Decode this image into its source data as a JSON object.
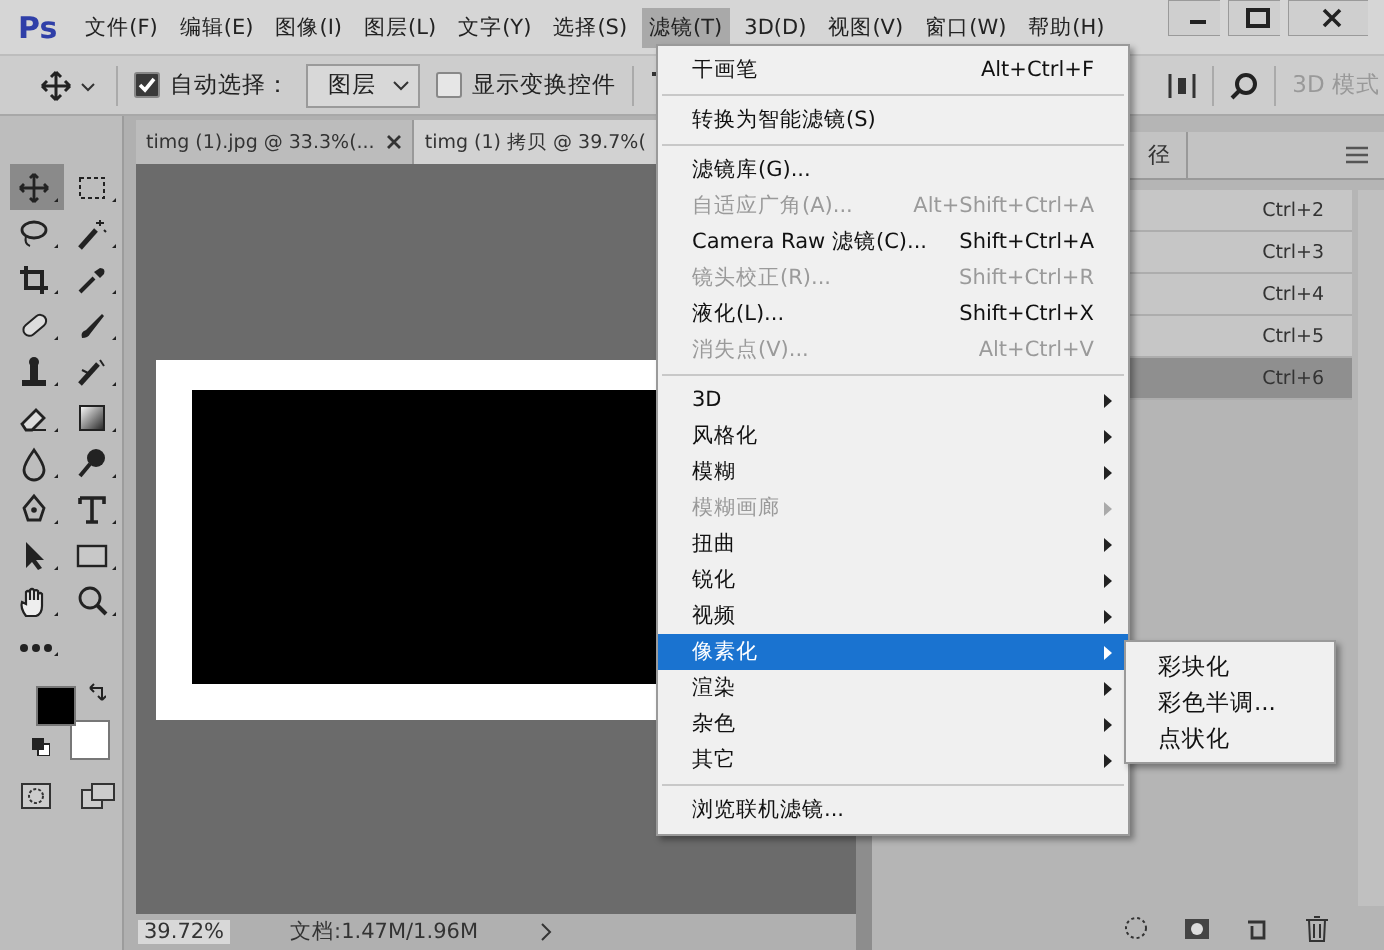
{
  "app_logo": "Ps",
  "menu_bar": [
    {
      "label": "文件(F)",
      "selected": false
    },
    {
      "label": "编辑(E)",
      "selected": false
    },
    {
      "label": "图像(I)",
      "selected": false
    },
    {
      "label": "图层(L)",
      "selected": false
    },
    {
      "label": "文字(Y)",
      "selected": false
    },
    {
      "label": "选择(S)",
      "selected": false
    },
    {
      "label": "滤镜(T)",
      "selected": true
    },
    {
      "label": "3D(D)",
      "selected": false
    },
    {
      "label": "视图(V)",
      "selected": false
    },
    {
      "label": "窗口(W)",
      "selected": false
    },
    {
      "label": "帮助(H)",
      "selected": false
    }
  ],
  "options_bar": {
    "auto_select": {
      "label": "自动选择：",
      "checked": true
    },
    "target": {
      "value": "图层"
    },
    "show_transform": {
      "label": "显示变换控件",
      "checked": false
    },
    "mode_3d": {
      "label": "3D 模式",
      "disabled": true
    }
  },
  "document_tabs": [
    {
      "label": "timg (1).jpg @ 33.3%(...",
      "selected": false
    },
    {
      "label": "timg (1) 拷贝 @ 39.7%(",
      "selected": true
    }
  ],
  "tools": [
    {
      "kind": "move",
      "selected": true
    },
    {
      "kind": "marquee",
      "selected": false
    },
    {
      "kind": "lasso",
      "selected": false
    },
    {
      "kind": "wand",
      "selected": false
    },
    {
      "kind": "crop",
      "selected": false
    },
    {
      "kind": "eyedropper",
      "selected": false
    },
    {
      "kind": "healing",
      "selected": false
    },
    {
      "kind": "brush",
      "selected": false
    },
    {
      "kind": "stamp",
      "selected": false
    },
    {
      "kind": "history",
      "selected": false
    },
    {
      "kind": "eraser",
      "selected": false
    },
    {
      "kind": "gradient",
      "selected": false
    },
    {
      "kind": "blur",
      "selected": false
    },
    {
      "kind": "dodge",
      "selected": false
    },
    {
      "kind": "pen",
      "selected": false
    },
    {
      "kind": "type",
      "selected": false
    },
    {
      "kind": "select",
      "selected": false
    },
    {
      "kind": "shape",
      "selected": false
    },
    {
      "kind": "hand",
      "selected": false
    },
    {
      "kind": "zoom",
      "selected": false
    },
    {
      "kind": "more",
      "selected": false
    }
  ],
  "swatches": [
    {
      "kind": "foreground",
      "color": "#000000"
    },
    {
      "kind": "background",
      "color": "#ffffff"
    }
  ],
  "status_bar": {
    "zoom": "39.72%",
    "document": "文档:1.47M/1.96M"
  },
  "panel": {
    "tab": "径",
    "rows": [
      {
        "shortcut": "Ctrl+2",
        "selected": false
      },
      {
        "shortcut": "Ctrl+3",
        "selected": false
      },
      {
        "shortcut": "Ctrl+4",
        "selected": false
      },
      {
        "shortcut": "Ctrl+5",
        "selected": false
      },
      {
        "shortcut": "Ctrl+6",
        "selected": true
      }
    ]
  },
  "filter_menu": [
    {
      "kind": "item",
      "label": "干画笔",
      "shortcut": "Alt+Ctrl+F",
      "disabled": false,
      "submenu": false,
      "selected": false
    },
    {
      "kind": "separator"
    },
    {
      "kind": "item",
      "label": "转换为智能滤镜(S)",
      "disabled": false,
      "submenu": false,
      "selected": false
    },
    {
      "kind": "separator"
    },
    {
      "kind": "item",
      "label": "滤镜库(G)...",
      "disabled": false,
      "submenu": false,
      "selected": false
    },
    {
      "kind": "item",
      "label": "自适应广角(A)...",
      "shortcut": "Alt+Shift+Ctrl+A",
      "disabled": true,
      "submenu": false,
      "selected": false
    },
    {
      "kind": "item",
      "label": "Camera Raw 滤镜(C)...",
      "shortcut": "Shift+Ctrl+A",
      "disabled": false,
      "submenu": false,
      "selected": false
    },
    {
      "kind": "item",
      "label": "镜头校正(R)...",
      "shortcut": "Shift+Ctrl+R",
      "disabled": true,
      "submenu": false,
      "selected": false
    },
    {
      "kind": "item",
      "label": "液化(L)...",
      "shortcut": "Shift+Ctrl+X",
      "disabled": false,
      "submenu": false,
      "selected": false
    },
    {
      "kind": "item",
      "label": "消失点(V)...",
      "shortcut": "Alt+Ctrl+V",
      "disabled": true,
      "submenu": false,
      "selected": false
    },
    {
      "kind": "separator"
    },
    {
      "kind": "item",
      "label": "3D",
      "disabled": false,
      "submenu": true,
      "selected": false
    },
    {
      "kind": "item",
      "label": "风格化",
      "disabled": false,
      "submenu": true,
      "selected": false
    },
    {
      "kind": "item",
      "label": "模糊",
      "disabled": false,
      "submenu": true,
      "selected": false
    },
    {
      "kind": "item",
      "label": "模糊画廊",
      "disabled": true,
      "submenu": true,
      "selected": false
    },
    {
      "kind": "item",
      "label": "扭曲",
      "disabled": false,
      "submenu": true,
      "selected": false
    },
    {
      "kind": "item",
      "label": "锐化",
      "disabled": false,
      "submenu": true,
      "selected": false
    },
    {
      "kind": "item",
      "label": "视频",
      "disabled": false,
      "submenu": true,
      "selected": false
    },
    {
      "kind": "item",
      "label": "像素化",
      "disabled": false,
      "submenu": true,
      "selected": true
    },
    {
      "kind": "item",
      "label": "渲染",
      "disabled": false,
      "submenu": true,
      "selected": false
    },
    {
      "kind": "item",
      "label": "杂色",
      "disabled": false,
      "submenu": true,
      "selected": false
    },
    {
      "kind": "item",
      "label": "其它",
      "disabled": false,
      "submenu": true,
      "selected": false
    },
    {
      "kind": "separator"
    },
    {
      "kind": "item",
      "label": "浏览联机滤镜...",
      "disabled": false,
      "submenu": false,
      "selected": false
    }
  ],
  "pixelate_submenu": [
    "彩块化",
    "彩色半调...",
    "点状化"
  ]
}
